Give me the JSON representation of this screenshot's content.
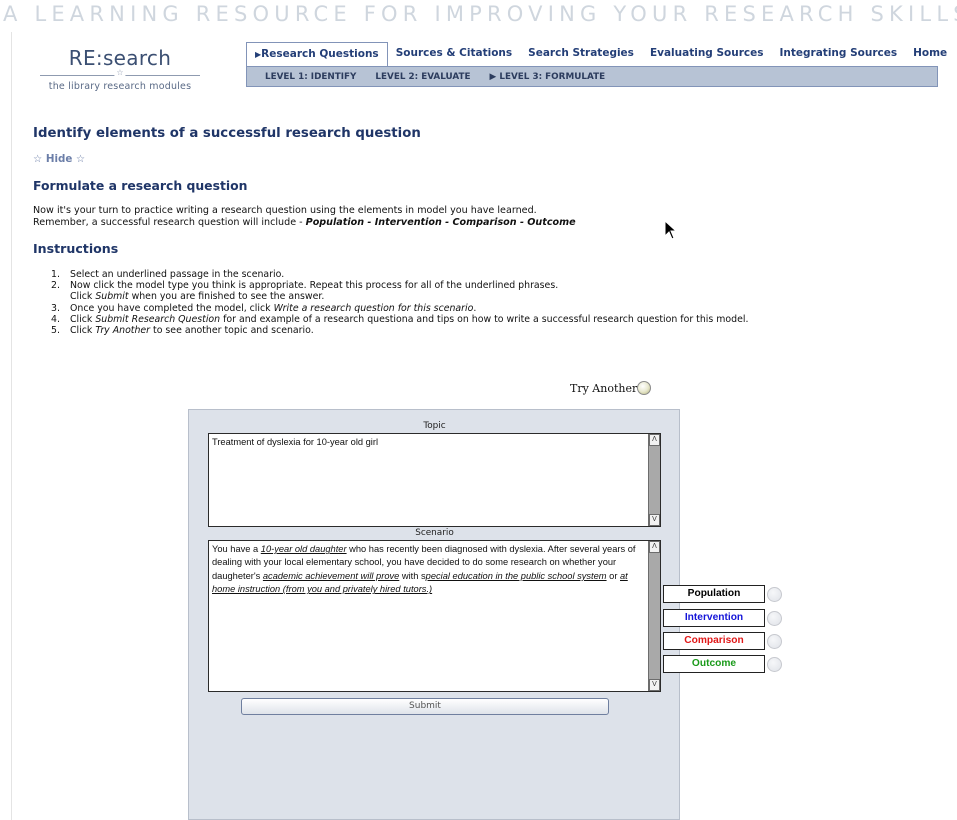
{
  "banner": "A LEARNING RESOURCE FOR IMPROVING YOUR RESEARCH SKILLS",
  "logo": {
    "title": "RE:search",
    "subtitle": "the library research modules"
  },
  "nav": {
    "items": [
      {
        "label": "Research Questions",
        "active": true
      },
      {
        "label": "Sources & Citations"
      },
      {
        "label": "Search Strategies"
      },
      {
        "label": "Evaluating Sources"
      },
      {
        "label": "Integrating Sources"
      },
      {
        "label": "Home"
      }
    ]
  },
  "subnav": {
    "items": [
      {
        "label": "LEVEL 1: IDENTIFY"
      },
      {
        "label": "LEVEL 2: EVALUATE"
      },
      {
        "label": "LEVEL 3: FORMULATE",
        "active": true
      }
    ]
  },
  "content": {
    "heading": "Identify elements of a successful research question",
    "hide_label": "Hide",
    "subheading": "Formulate a research question",
    "intro_line1": "Now it's your turn to practice writing a research question using the elements in model you have learned.",
    "intro_line2_prefix": "Remember, a successful research question will include - ",
    "intro_line2_bold": "Population - Intervention - Comparison - Outcome",
    "instructions_title": "Instructions",
    "steps": [
      {
        "num": "1.",
        "text": "Select an underlined passage in the scenario."
      },
      {
        "num": "2.",
        "text": "Now click the model type you think is appropriate. Repeat this process for all of the underlined phrases.",
        "text2_pre": "Click ",
        "text2_em": "Submit",
        "text2_post": " when you are finished to see the answer."
      },
      {
        "num": "3.",
        "pre": "Once you have completed the model, click ",
        "em": "Write a research question for this scenario",
        "post": "."
      },
      {
        "num": "4.",
        "pre": "Click ",
        "em": "Submit Research Question",
        "post": " for and example of a research questiona and tips on how to write a successful research question for this model."
      },
      {
        "num": "5.",
        "pre": "Click ",
        "em": "Try Another",
        "post": " to see another topic and scenario."
      }
    ]
  },
  "try_another": "Try Another",
  "exercise": {
    "topic_label": "Topic",
    "topic_text": "Treatment of dyslexia for 10-year old girl",
    "scenario_label": "Scenario",
    "scenario": {
      "p1": "You have a ",
      "u1": "10-year old daughter",
      "p2": " who has recently been diagnosed with dyslexia. After several years of dealing with your local elementary school, you have decided to do some research on whether your daugheter's ",
      "u2": "academic achievement will prove",
      "p3": " with s",
      "u3": "pecial education in the public school system",
      "p4": " or ",
      "u4": "at home instruction (from you and privately hired tutors.)",
      "p5": ""
    },
    "scroll_up": "Λ",
    "scroll_down": "V",
    "submit_label": "Submit",
    "options": [
      {
        "label": "Population",
        "color": "#000000"
      },
      {
        "label": "Intervention",
        "color": "#1414d8"
      },
      {
        "label": "Comparison",
        "color": "#e01818"
      },
      {
        "label": "Outcome",
        "color": "#1a9a1a"
      }
    ]
  }
}
